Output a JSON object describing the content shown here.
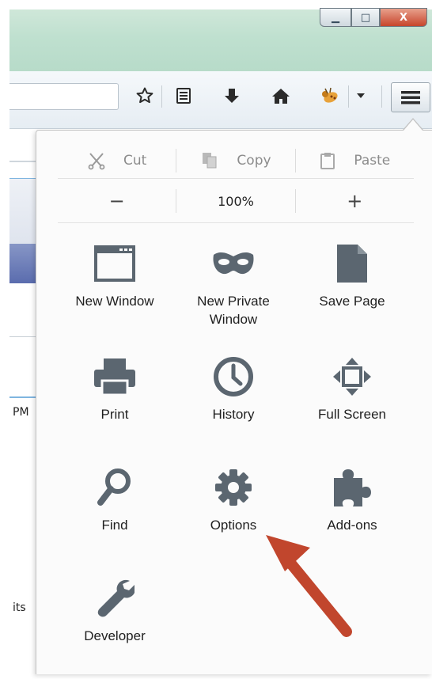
{
  "window": {
    "minimize_glyph": "▁",
    "maximize_glyph": "□",
    "close_glyph": "X"
  },
  "toolbar": {
    "icons": [
      "bookmark-star-icon",
      "reading-list-icon",
      "download-icon",
      "home-icon",
      "firebug-icon",
      "dropdown-icon"
    ],
    "menu_icon": "hamburger-menu-icon"
  },
  "background_page": {
    "snippet_time": "PM",
    "snippet_word": "its"
  },
  "menu_panel": {
    "edit": {
      "cut": "Cut",
      "copy": "Copy",
      "paste": "Paste"
    },
    "zoom": {
      "decrease": "−",
      "level": "100%",
      "increase": "+"
    },
    "items": [
      {
        "label": "New Window",
        "icon": "new-window-icon"
      },
      {
        "label": "New Private\nWindow",
        "icon": "private-mask-icon"
      },
      {
        "label": "Save Page",
        "icon": "save-page-icon"
      },
      {
        "label": "Print",
        "icon": "printer-icon"
      },
      {
        "label": "History",
        "icon": "clock-icon"
      },
      {
        "label": "Full Screen",
        "icon": "fullscreen-arrows-icon"
      },
      {
        "label": "Find",
        "icon": "magnifier-icon"
      },
      {
        "label": "Options",
        "icon": "gear-icon"
      },
      {
        "label": "Add-ons",
        "icon": "puzzle-piece-icon"
      },
      {
        "label": "Developer",
        "icon": "wrench-icon"
      }
    ]
  },
  "colors": {
    "icon_gray": "#5b6670",
    "arrow_red": "#c1462d"
  }
}
